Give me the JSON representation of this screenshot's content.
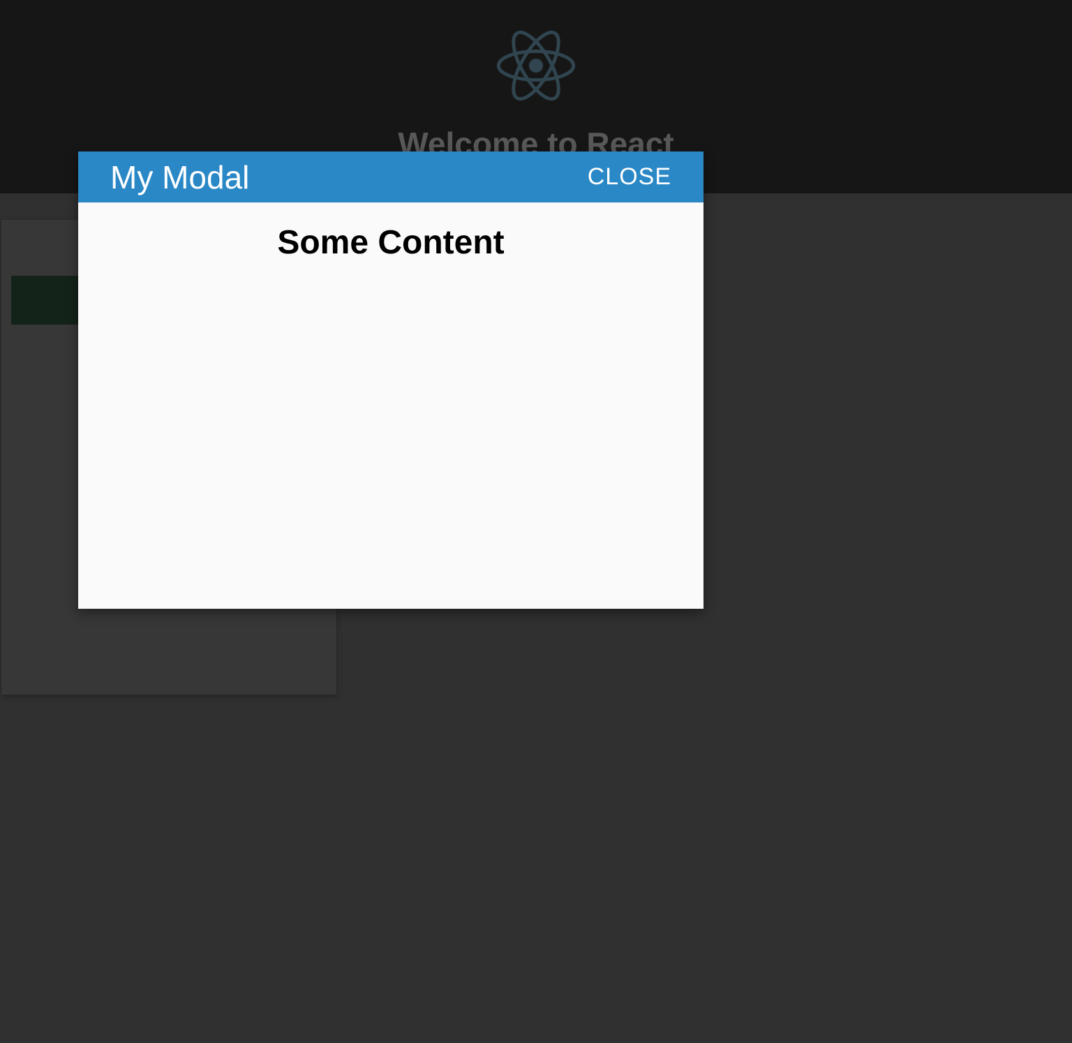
{
  "header": {
    "title": "Welcome to React",
    "logo_name": "react-logo-icon"
  },
  "modal": {
    "title": "My Modal",
    "close_label": "CLOSE",
    "content_heading": "Some Content"
  },
  "colors": {
    "header_bg": "#222222",
    "modal_header_bg": "#2a88c6",
    "modal_body_bg": "#fafafa",
    "page_bg": "#4a4a4a"
  }
}
